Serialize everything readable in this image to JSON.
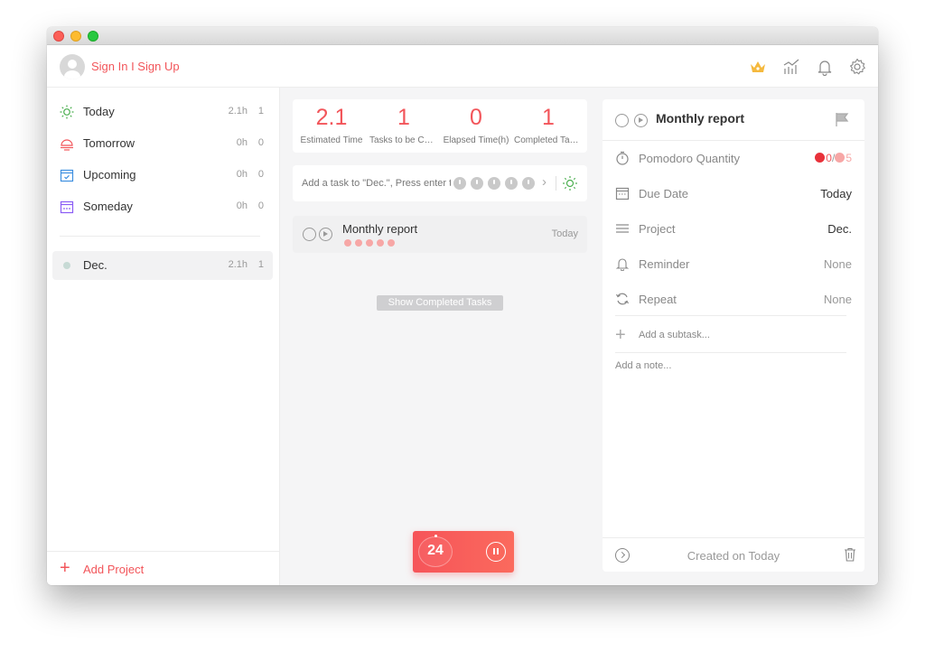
{
  "header": {
    "signin_label": "Sign In I Sign Up"
  },
  "sidebar": {
    "items": [
      {
        "label": "Today",
        "time": "2.1h",
        "count": "1"
      },
      {
        "label": "Tomorrow",
        "time": "0h",
        "count": "0"
      },
      {
        "label": "Upcoming",
        "time": "0h",
        "count": "0"
      },
      {
        "label": "Someday",
        "time": "0h",
        "count": "0"
      }
    ],
    "project": {
      "label": "Dec.",
      "time": "2.1h",
      "count": "1"
    },
    "add_project_label": "Add Project"
  },
  "stats": [
    {
      "value": "2.1",
      "caption": "Estimated Time"
    },
    {
      "value": "1",
      "caption": "Tasks to be Completed"
    },
    {
      "value": "0",
      "caption": "Elapsed Time(h)"
    },
    {
      "value": "1",
      "caption": "Completed Tasks"
    }
  ],
  "add_task": {
    "placeholder": "Add a task to \"Dec.\", Press enter to save"
  },
  "task": {
    "title": "Monthly report",
    "due": "Today",
    "pomodoros": 5
  },
  "show_completed_label": "Show Completed Tasks",
  "timer": {
    "value": "24"
  },
  "detail": {
    "title": "Monthly report",
    "pomodoro_label": "Pomodoro Quantity",
    "pomodoro_done": "0",
    "pomodoro_sep": "/",
    "pomodoro_total": "5",
    "due_label": "Due Date",
    "due_value": "Today",
    "project_label": "Project",
    "project_value": "Dec.",
    "reminder_label": "Reminder",
    "reminder_value": "None",
    "repeat_label": "Repeat",
    "repeat_value": "None",
    "subtask_placeholder": "Add a subtask...",
    "note_placeholder": "Add a note...",
    "created": "Created on Today"
  },
  "colors": {
    "accent": "#f2555a",
    "sun": "#4caf50",
    "tomorrow": "#f2555a",
    "upcoming": "#3d8fe0",
    "someday": "#8a5cf5"
  }
}
